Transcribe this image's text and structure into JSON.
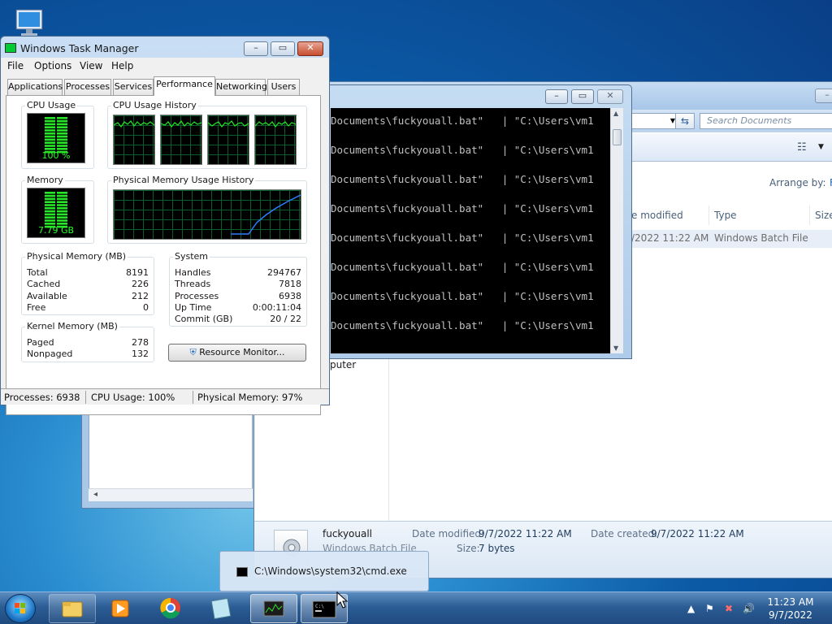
{
  "desktop": {
    "icon_name": "computer-icon"
  },
  "explorer": {
    "search_placeholder": "Search Documents",
    "arrange_label": "Arrange by:",
    "arrange_value": "F",
    "columns": [
      "e modified",
      "Type",
      "Size"
    ],
    "file_row": {
      "date": "/2022 11:22 AM",
      "type": "Windows Batch File"
    },
    "nav_computer": "puter",
    "details": {
      "name": "fuckyouall",
      "type": "Windows Batch File",
      "modified_label": "Date modified:",
      "modified_value": "9/7/2022 11:22 AM",
      "created_label": "Date created:",
      "created_value": "9/7/2022 11:22 AM",
      "size_label": "Size:",
      "size_value": "7 bytes"
    }
  },
  "cmd": {
    "lines": [
      "Documents\\fuckyouall.bat\"   | \"C:\\Users\\vm1",
      "Documents\\fuckyouall.bat\"   | \"C:\\Users\\vm1",
      "Documents\\fuckyouall.bat\"   | \"C:\\Users\\vm1",
      "Documents\\fuckyouall.bat\"   | \"C:\\Users\\vm1",
      "Documents\\fuckyouall.bat\"   | \"C:\\Users\\vm1",
      "Documents\\fuckyouall.bat\"   | \"C:\\Users\\vm1",
      "Documents\\fuckyouall.bat\"   | \"C:\\Users\\vm1",
      "Documents\\fuckyouall.bat\"   | \"C:\\Users\\vm1"
    ]
  },
  "taskmgr": {
    "title": "Windows Task Manager",
    "menu": [
      "File",
      "Options",
      "View",
      "Help"
    ],
    "tabs": [
      "Applications",
      "Processes",
      "Services",
      "Performance",
      "Networking",
      "Users"
    ],
    "active_tab": "Performance",
    "cpu_usage_label": "CPU Usage",
    "cpu_usage_value": "100 %",
    "cpu_usage_fraction": 1.0,
    "cpu_history_label": "CPU Usage History",
    "memory_label": "Memory",
    "memory_value": "7.79 GB",
    "memory_fraction": 0.97,
    "mem_history_label": "Physical Memory Usage History",
    "physical_memory": {
      "label": "Physical Memory (MB)",
      "rows": [
        {
          "k": "Total",
          "v": "8191"
        },
        {
          "k": "Cached",
          "v": "226"
        },
        {
          "k": "Available",
          "v": "212"
        },
        {
          "k": "Free",
          "v": "0"
        }
      ]
    },
    "kernel_memory": {
      "label": "Kernel Memory (MB)",
      "rows": [
        {
          "k": "Paged",
          "v": "278"
        },
        {
          "k": "Nonpaged",
          "v": "132"
        }
      ]
    },
    "system": {
      "label": "System",
      "rows": [
        {
          "k": "Handles",
          "v": "294767"
        },
        {
          "k": "Threads",
          "v": "7818"
        },
        {
          "k": "Processes",
          "v": "6938"
        },
        {
          "k": "Up Time",
          "v": "0:00:11:04"
        },
        {
          "k": "Commit (GB)",
          "v": "20 / 22"
        }
      ]
    },
    "resource_monitor_label": "Resource Monitor...",
    "status": {
      "processes": "Processes: 6938",
      "cpu": "CPU Usage: 100%",
      "memory": "Physical Memory: 97%"
    }
  },
  "taskbar": {
    "thumbnail_title": "C:\\Windows\\system32\\cmd.exe",
    "clock_time": "11:23 AM",
    "clock_date": "9/7/2022",
    "buttons": [
      "explorer-icon",
      "media-player-icon",
      "chrome-icon",
      "notepad-icon",
      "task-manager-icon",
      "cmd-icon"
    ]
  }
}
